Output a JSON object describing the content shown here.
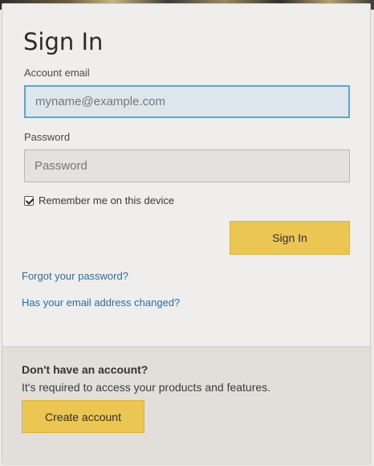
{
  "form": {
    "title": "Sign In",
    "email_label": "Account email",
    "email_placeholder": "myname@example.com",
    "password_label": "Password",
    "password_placeholder": "Password",
    "remember_label": "Remember me on this device",
    "remember_checked": true,
    "signin_label": "Sign In",
    "forgot_link": "Forgot your password?",
    "email_changed_link": "Has your email address changed?"
  },
  "signup": {
    "heading": "Don't have an account?",
    "description": "It's required to access your products and features.",
    "create_label": "Create account"
  },
  "colors": {
    "accent": "#ebc652",
    "link": "#2a6da7",
    "focus": "#5fa6c9"
  }
}
